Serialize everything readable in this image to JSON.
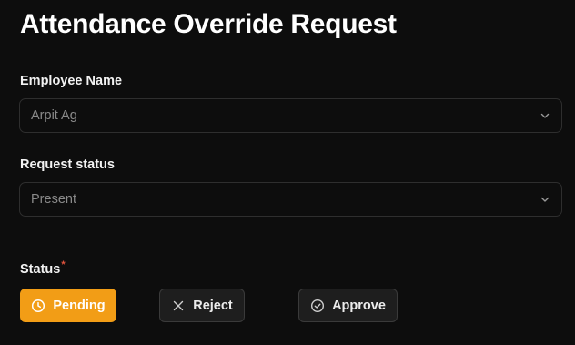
{
  "page": {
    "title": "Attendance Override Request"
  },
  "form": {
    "employee": {
      "label": "Employee Name",
      "value": "Arpit Ag",
      "icon": "chevron-down-icon"
    },
    "request_status": {
      "label": "Request status",
      "value": "Present",
      "icon": "chevron-down-icon"
    },
    "status": {
      "label": "Status",
      "required_marker": "*",
      "options": [
        {
          "label": "Pending",
          "icon": "clock-icon",
          "selected": true
        },
        {
          "label": "Reject",
          "icon": "close-icon",
          "selected": false
        },
        {
          "label": "Approve",
          "icon": "check-circle-icon",
          "selected": false
        }
      ]
    }
  },
  "colors": {
    "background": "#0d0d0d",
    "accent": "#f29d16",
    "required": "#e0533d"
  }
}
